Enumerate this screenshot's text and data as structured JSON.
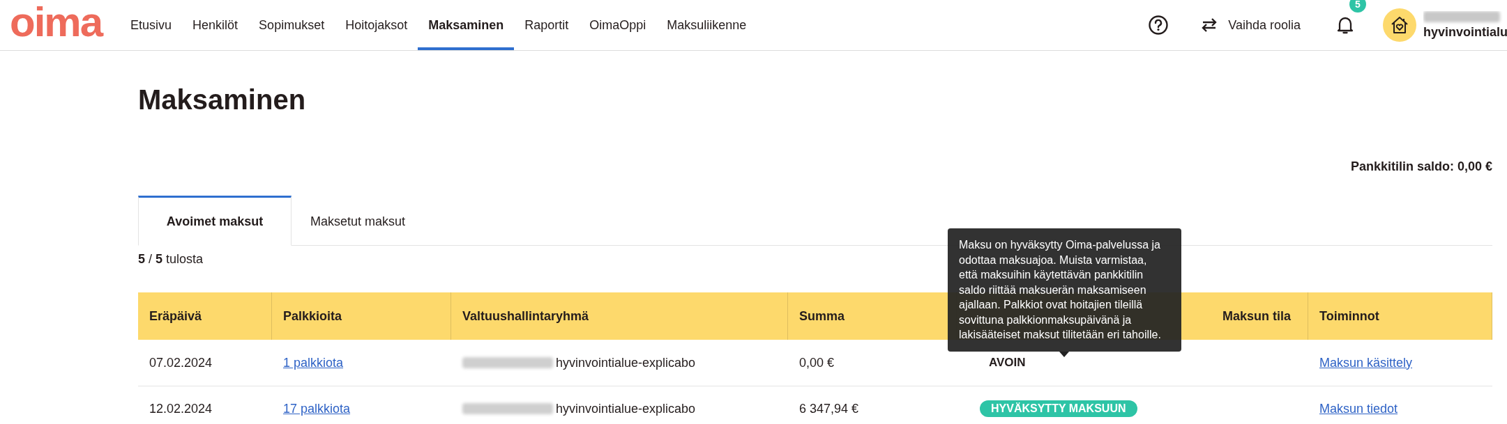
{
  "header": {
    "logo": "oima",
    "nav": [
      {
        "label": "Etusivu",
        "selected": false
      },
      {
        "label": "Henkilöt",
        "selected": false
      },
      {
        "label": "Sopimukset",
        "selected": false
      },
      {
        "label": "Hoitojaksot",
        "selected": false
      },
      {
        "label": "Maksaminen",
        "selected": true
      },
      {
        "label": "Raportit",
        "selected": false
      },
      {
        "label": "OimaOppi",
        "selected": false
      },
      {
        "label": "Maksuliikenne",
        "selected": false
      }
    ],
    "role_switch": "Vaihda roolia",
    "notification_count": "5",
    "user_organization": "hyvinvointialu"
  },
  "page": {
    "title": "Maksaminen",
    "bank_balance": "Pankkitilin saldo: 0,00 €",
    "tabs": [
      {
        "label": "Avoimet maksut",
        "selected": true
      },
      {
        "label": "Maksetut maksut",
        "selected": false
      }
    ],
    "result_count": "**5** / **5** tulosta",
    "table": {
      "columns": [
        "Eräpäivä",
        "Palkkioita",
        "Valtuushallintaryhmä",
        "Summa",
        "Maksun tila",
        "Toiminnot"
      ],
      "rows": [
        {
          "due_date": "07.02.2024",
          "fees": "1 palkkiota",
          "group": "hyvinvointialue-explicabo",
          "sum": "0,00 €",
          "status": {
            "kind": "plain",
            "label": "AVOIN"
          },
          "action": "Maksun käsittely"
        },
        {
          "due_date": "12.02.2024",
          "fees": "17 palkkiota",
          "group": "hyvinvointialue-explicabo",
          "sum": "6 347,94 €",
          "status": {
            "kind": "badge",
            "label": "HYVÄKSYTTY MAKSUUN"
          },
          "action": "Maksun tiedot"
        }
      ]
    },
    "tooltip": "Maksu on hyväksytty Oima-palvelussa ja odottaa maksuajoa. Muista varmistaa, että maksuihin käytettävän pankkitilin saldo riittää maksuerän maksamiseen ajallaan. Palkkiot ovat hoitajien tileillä sovittuna palkkionmaksupäivänä ja lakisääteiset maksut tilitetään eri tahoille."
  }
}
